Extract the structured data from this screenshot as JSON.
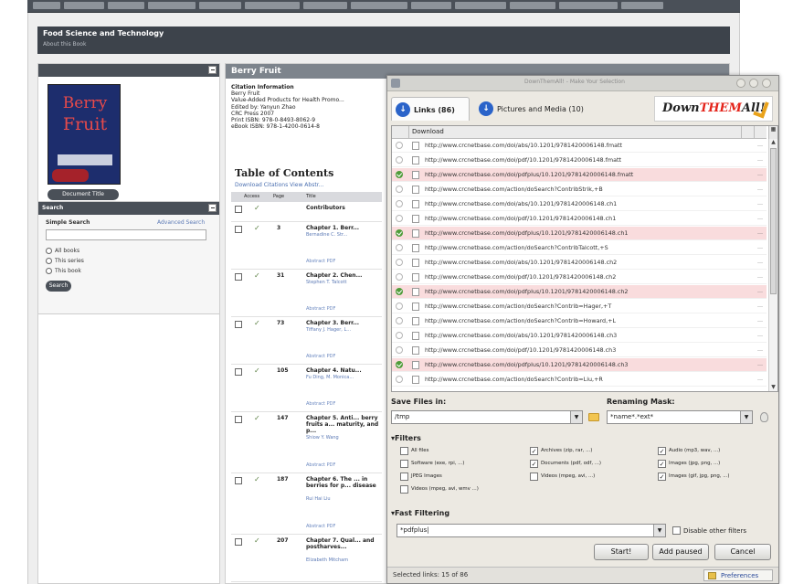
{
  "site": {
    "title": "Food Science and Technology",
    "subtitle": "About this Book"
  },
  "left": {
    "cover_title_line1": "Berry",
    "cover_title_line2": "Fruit",
    "documents_button": "Document Title",
    "search_title": "Search",
    "simple_search": "Simple Search",
    "advanced_search": "Advanced Search",
    "options": [
      "All books",
      "This series",
      "This book"
    ],
    "search_button": "Search"
  },
  "main": {
    "book_title": "Berry Fruit",
    "citation_lines": [
      "Citation Information",
      "Berry Fruit",
      "Value-Added Products for Health Promo...",
      "Edited by: Yanyun Zhao",
      "CRC Press 2007",
      "Print ISBN: 978-0-8493-8062-9",
      "eBook ISBN: 978-1-4200-0614-8"
    ],
    "toc_title": "Table of Contents",
    "toc_tools": "Download Citations   View Abstr...",
    "toc_headers": [
      "Access",
      "Page",
      "Title"
    ],
    "toc_rows": [
      {
        "page": "",
        "title": "Contributors",
        "author": "",
        "abstract": ""
      },
      {
        "page": "3",
        "title": "Chapter 1. Berr...",
        "author": "Bernadine C. Str...",
        "abstract": "Abstract    PDF"
      },
      {
        "page": "31",
        "title": "Chapter 2. Chen...",
        "author": "Stephen T. Talcott",
        "abstract": "Abstract    PDF"
      },
      {
        "page": "73",
        "title": "Chapter 3. Berr...",
        "author": "Tiffany J. Hager, L...",
        "abstract": "Abstract    PDF"
      },
      {
        "page": "105",
        "title": "Chapter 4. Natu...",
        "author": "Fu Ding, M. Monica...",
        "abstract": "Abstract    PDF"
      },
      {
        "page": "147",
        "title": "Chapter 5. Anti... berry fruits a... maturity, and p...",
        "author": "Shiow Y. Wang",
        "abstract": "Abstract    PDF"
      },
      {
        "page": "187",
        "title": "Chapter 6. The ... in berries for p... disease",
        "author": "Rui Hai Liu",
        "abstract": "Abstract    PDF"
      },
      {
        "page": "207",
        "title": "Chapter 7. Qual... and postharves...",
        "author": "Elizabeth Mitcham",
        "abstract": ""
      }
    ]
  },
  "dta": {
    "window_title": "DownThemAll! - Make Your Selection",
    "tab_links": "Links (86)",
    "tab_media": "Pictures and Media (10)",
    "logo_part1": "Down",
    "logo_part2": "THEM",
    "logo_part3": "All!",
    "column_download": "Download",
    "links": [
      {
        "url": "http://www.crcnetbase.com/doi/abs/10.1201/9781420006148.fmatt",
        "selected": false
      },
      {
        "url": "http://www.crcnetbase.com/doi/pdf/10.1201/9781420006148.fmatt",
        "selected": false
      },
      {
        "url": "http://www.crcnetbase.com/doi/pdfplus/10.1201/9781420006148.fmatt",
        "selected": true
      },
      {
        "url": "http://www.crcnetbase.com/action/doSearch?ContribStrik,+B",
        "selected": false
      },
      {
        "url": "http://www.crcnetbase.com/doi/abs/10.1201/9781420006148.ch1",
        "selected": false
      },
      {
        "url": "http://www.crcnetbase.com/doi/pdf/10.1201/9781420006148.ch1",
        "selected": false
      },
      {
        "url": "http://www.crcnetbase.com/doi/pdfplus/10.1201/9781420006148.ch1",
        "selected": true
      },
      {
        "url": "http://www.crcnetbase.com/action/doSearch?ContribTalcott,+S",
        "selected": false
      },
      {
        "url": "http://www.crcnetbase.com/doi/abs/10.1201/9781420006148.ch2",
        "selected": false
      },
      {
        "url": "http://www.crcnetbase.com/doi/pdf/10.1201/9781420006148.ch2",
        "selected": false
      },
      {
        "url": "http://www.crcnetbase.com/doi/pdfplus/10.1201/9781420006148.ch2",
        "selected": true
      },
      {
        "url": "http://www.crcnetbase.com/action/doSearch?Contrib=Hager,+T",
        "selected": false
      },
      {
        "url": "http://www.crcnetbase.com/action/doSearch?Contrib=Howard,+L",
        "selected": false
      },
      {
        "url": "http://www.crcnetbase.com/doi/abs/10.1201/9781420006148.ch3",
        "selected": false
      },
      {
        "url": "http://www.crcnetbase.com/doi/pdf/10.1201/9781420006148.ch3",
        "selected": false
      },
      {
        "url": "http://www.crcnetbase.com/doi/pdfplus/10.1201/9781420006148.ch3",
        "selected": true
      },
      {
        "url": "http://www.crcnetbase.com/action/doSearch?Contrib=Liu,+R",
        "selected": false
      }
    ],
    "save_files_in_label": "Save Files in:",
    "save_folder": "/tmp",
    "renaming_mask_label": "Renaming Mask:",
    "renaming_mask": "*name*.*ext*",
    "filters_label": "Filters",
    "filters": [
      {
        "label": "All files",
        "checked": false
      },
      {
        "label": "Archives (zip, rar, ...)",
        "checked": true
      },
      {
        "label": "Audio (mp3, wav, ...)",
        "checked": true
      },
      {
        "label": "Software (exe, rpi, ...)",
        "checked": false
      },
      {
        "label": "Documents (pdf, odf, ...)",
        "checked": true
      },
      {
        "label": "Images (jpg, png, ...)",
        "checked": true
      },
      {
        "label": "JPEG Images",
        "checked": false
      },
      {
        "label": "Videos (mpeg, avi, ...)",
        "checked": false
      },
      {
        "label": "Images (gif, jpg, png, ...)",
        "checked": true
      },
      {
        "label": "Videos (mpeg, avi, wmv ...)",
        "checked": false
      }
    ],
    "fast_filtering_label": "Fast Filtering",
    "fast_filter_value": "*pdfplus|",
    "disable_other_filters": "Disable other filters",
    "start_button": "Start!",
    "add_paused_button": "Add paused",
    "cancel_button": "Cancel",
    "status": "Selected links: 15 of 86",
    "preferences": "Preferences"
  },
  "colors": {
    "selected_row": "#f9dcdd",
    "accent": "#2a63c9",
    "nav_dark": "#4a5058"
  }
}
